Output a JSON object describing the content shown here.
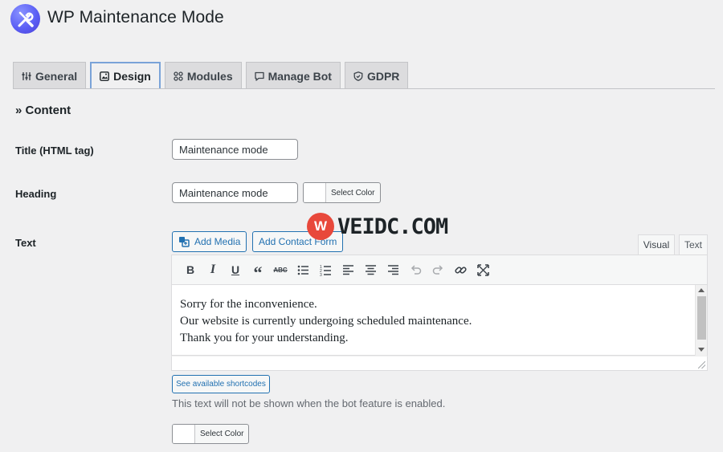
{
  "app": {
    "title": "WP Maintenance Mode",
    "logo_icon": "wrench-screwdriver-icon",
    "logo_color": "#5b5ff5"
  },
  "tabs": [
    {
      "label": "General",
      "icon": "sliders-icon",
      "active": false
    },
    {
      "label": "Design",
      "icon": "image-icon",
      "active": true
    },
    {
      "label": "Modules",
      "icon": "modules-icon",
      "active": false
    },
    {
      "label": "Manage Bot",
      "icon": "chat-icon",
      "active": false
    },
    {
      "label": "GDPR",
      "icon": "shield-icon",
      "active": false
    }
  ],
  "section": {
    "title": "» Content"
  },
  "fields": {
    "title_label": "Title (HTML tag)",
    "title_value": "Maintenance mode",
    "heading_label": "Heading",
    "heading_value": "Maintenance mode",
    "heading_color_label": "Select Color",
    "text_label": "Text"
  },
  "editor": {
    "add_media_label": "Add Media",
    "add_contact_form_label": "Add Contact Form",
    "tab_visual": "Visual",
    "tab_text": "Text",
    "toolbar_icons": [
      "bold-icon",
      "italic-icon",
      "underline-icon",
      "blockquote-icon",
      "strikethrough-icon",
      "bullet-list-icon",
      "numbered-list-icon",
      "align-left-icon",
      "align-center-icon",
      "align-right-icon",
      "undo-icon",
      "redo-icon",
      "link-icon",
      "fullscreen-icon"
    ],
    "lines": [
      "Sorry for the inconvenience.",
      "Our website is currently undergoing scheduled maintenance.",
      "Thank you for your understanding."
    ]
  },
  "shortcodes_button": "See available shortcodes",
  "description": "This text will not be shown when the bot feature is enabled.",
  "text_color_label": "Select Color",
  "watermark": {
    "badge": "W",
    "text": "VEIDC.COM"
  },
  "colors": {
    "accent": "#2271b1",
    "active_tab_border": "#7aa3d8",
    "watermark_red": "#e8483b"
  }
}
